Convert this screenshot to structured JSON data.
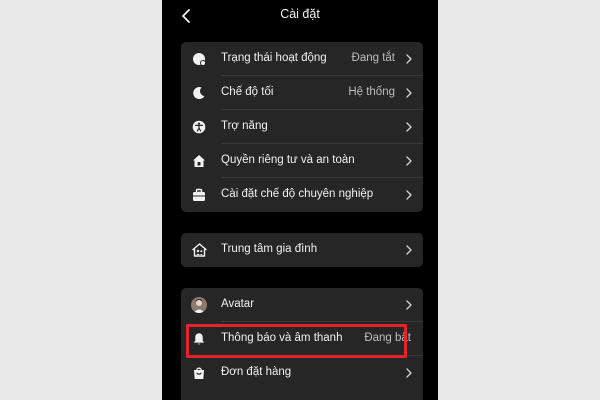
{
  "header": {
    "title": "Cài đặt"
  },
  "groups": [
    {
      "items": [
        {
          "label": "Trạng thái hoạt động",
          "value": "Đang tắt",
          "icon": "activity-status-icon"
        },
        {
          "label": "Chế độ tối",
          "value": "Hệ thống",
          "icon": "moon-icon"
        },
        {
          "label": "Trợ năng",
          "value": "",
          "icon": "accessibility-icon"
        },
        {
          "label": "Quyền riêng tư và an toàn",
          "value": "",
          "icon": "privacy-home-icon"
        },
        {
          "label": "Cài đặt chế độ chuyên nghiệp",
          "value": "",
          "icon": "briefcase-icon"
        }
      ]
    },
    {
      "items": [
        {
          "label": "Trung tâm gia đình",
          "value": "",
          "icon": "family-home-icon"
        }
      ]
    },
    {
      "items": [
        {
          "label": "Avatar",
          "value": "",
          "icon": "avatar-icon"
        },
        {
          "label": "Thông báo và âm thanh",
          "value": "Đang bật",
          "icon": "bell-icon"
        },
        {
          "label": "Đơn đặt hàng",
          "value": "",
          "icon": "shopping-bag-icon"
        }
      ]
    }
  ],
  "colors": {
    "background": "#000000",
    "card": "#262626",
    "highlight": "#e5232b"
  }
}
